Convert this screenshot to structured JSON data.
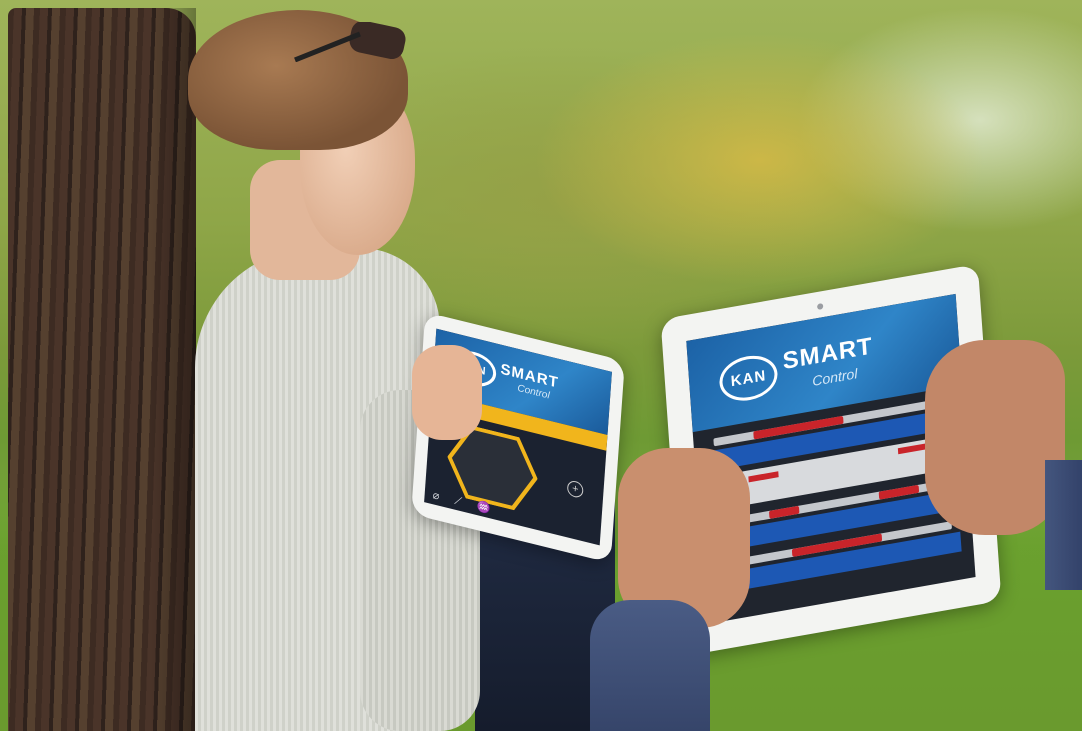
{
  "photo": {
    "subject": "",
    "left_tablet": {
      "logo_text": "KAN",
      "brand_main": "SMART",
      "brand_sub": "Control"
    },
    "right_tablet": {
      "logo_text": "KAN",
      "brand_main": "SMART",
      "brand_sub": "Control"
    }
  }
}
